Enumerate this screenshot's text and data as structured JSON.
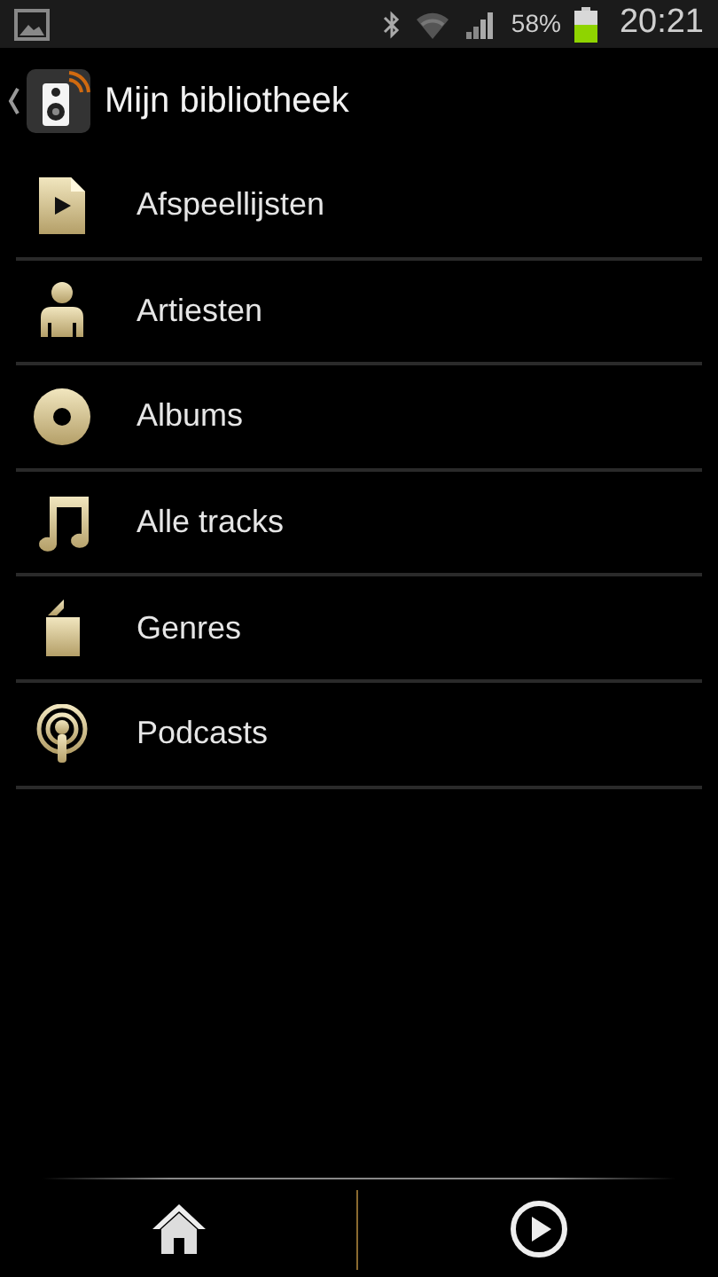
{
  "status_bar": {
    "battery": "58%",
    "time": "20:21"
  },
  "header": {
    "title": "Mijn bibliotheek"
  },
  "items": [
    {
      "kind": "playlist",
      "label": "Afspeellijsten"
    },
    {
      "kind": "artist",
      "label": "Artiesten"
    },
    {
      "kind": "album",
      "label": "Albums"
    },
    {
      "kind": "track",
      "label": "Alle tracks"
    },
    {
      "kind": "genre",
      "label": "Genres"
    },
    {
      "kind": "podcast",
      "label": "Podcasts"
    }
  ]
}
